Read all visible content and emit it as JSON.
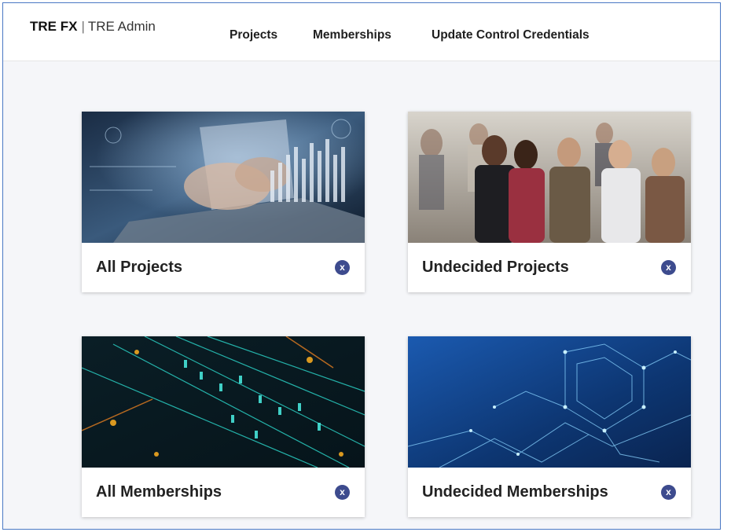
{
  "app": {
    "brand": "TRE FX",
    "separator": "|",
    "subtitle": "TRE Admin"
  },
  "nav": {
    "items": [
      {
        "label": "Projects"
      },
      {
        "label": "Memberships"
      },
      {
        "label": "Update Control Credentials"
      }
    ]
  },
  "cards": [
    {
      "title": "All Projects",
      "badge": "x",
      "image_icon": "laptop-analytics-image"
    },
    {
      "title": "Undecided Projects",
      "badge": "x",
      "image_icon": "people-meeting-image"
    },
    {
      "title": "All Memberships",
      "badge": "x",
      "image_icon": "binary-data-image"
    },
    {
      "title": "Undecided Memberships",
      "badge": "x",
      "image_icon": "circuit-network-image"
    }
  ],
  "colors": {
    "frame_border": "#4a78c4",
    "page_background": "#f5f6f9",
    "badge": "#3d4b8e"
  }
}
